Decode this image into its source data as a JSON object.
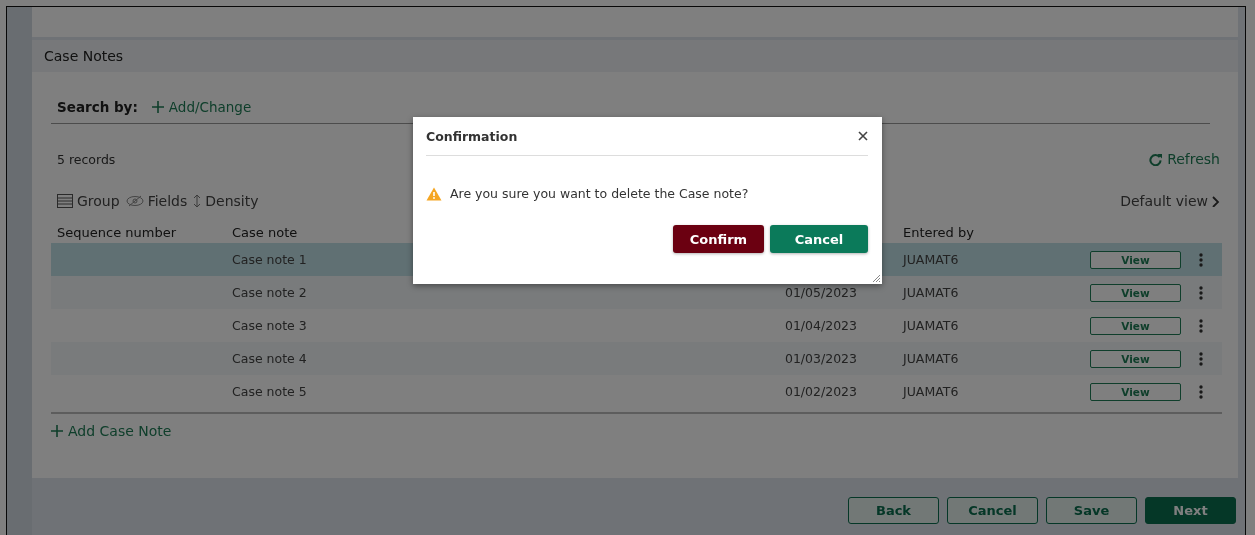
{
  "section": {
    "title": "Case Notes",
    "search_label": "Search by:",
    "add_change": "Add/Change",
    "record_count": "5 records",
    "refresh": "Refresh",
    "toolbar": [
      "Group",
      "Fields",
      "Density"
    ],
    "default_view": "Default view"
  },
  "table": {
    "columns": [
      {
        "label": "Sequence number"
      },
      {
        "label": "Case note"
      },
      {},
      {
        "label": "Entered by"
      }
    ],
    "rows": [
      {
        "case_note": "Case note 1",
        "entered_by": "JUAMAT6",
        "action": "View",
        "selected": true
      },
      {
        "case_note": "Case note 2",
        "date": "01/05/2023",
        "entered_by": "JUAMAT6",
        "action": "View",
        "selected": false
      },
      {
        "case_note": "Case note 3",
        "date": "01/04/2023",
        "entered_by": "JUAMAT6",
        "action": "View",
        "selected": false
      },
      {
        "case_note": "Case note 4",
        "date": "01/03/2023",
        "entered_by": "JUAMAT6",
        "action": "View",
        "selected": false
      },
      {
        "case_note": "Case note 5",
        "date": "01/02/2023",
        "entered_by": "JUAMAT6",
        "action": "View",
        "selected": false
      }
    ]
  },
  "add_case_note": "Add Case Note",
  "footer_buttons": [
    {
      "label": "Back",
      "kind": "outline"
    },
    {
      "label": "Cancel",
      "kind": "outline"
    },
    {
      "label": "Save",
      "kind": "outline"
    },
    {
      "label": "Next",
      "kind": "filled"
    }
  ],
  "dialog": {
    "title": "Confirmation",
    "message": "Are you sure you want to delete the Case note?",
    "buttons": [
      {
        "label": "Confirm",
        "kind": "danger"
      },
      {
        "label": "Cancel",
        "kind": "primary"
      }
    ]
  }
}
